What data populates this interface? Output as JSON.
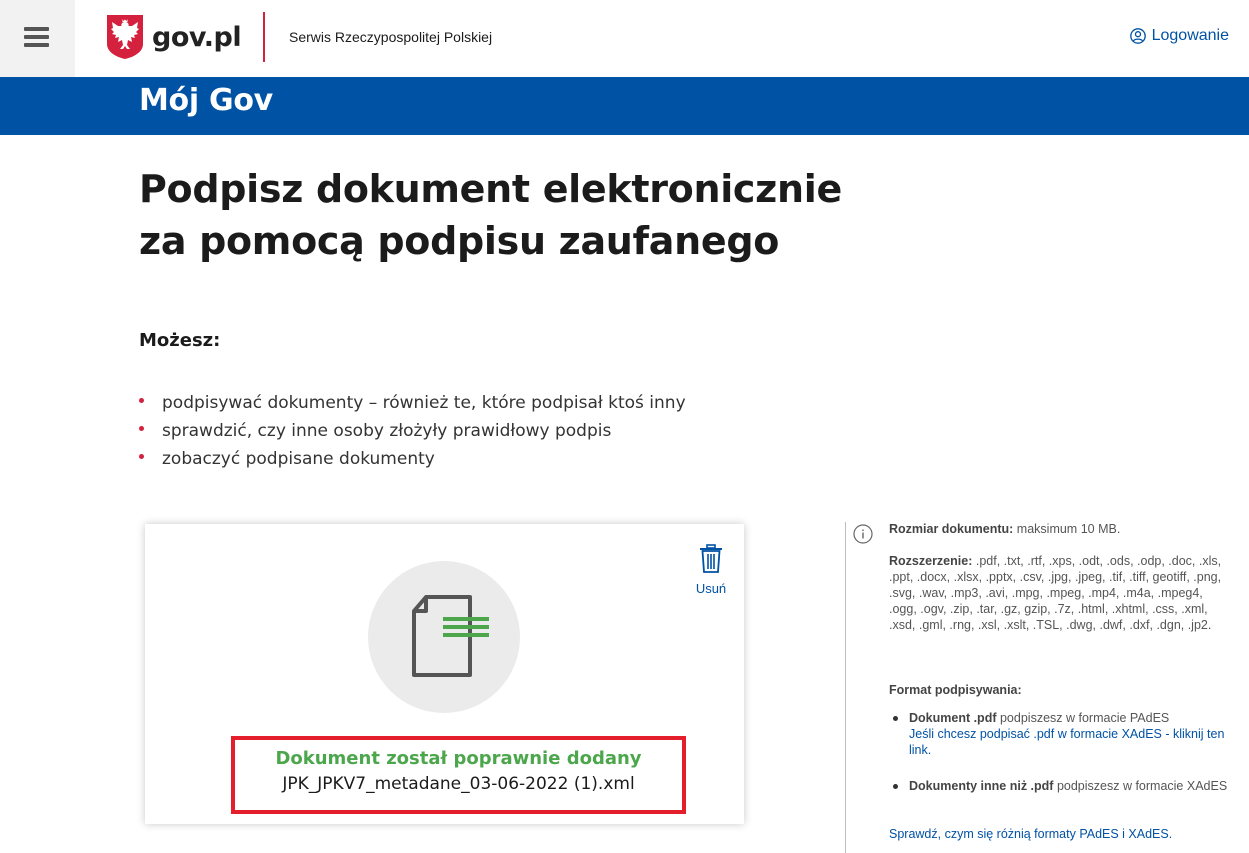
{
  "header": {
    "logo_text": "gov.pl",
    "service_name": "Serwis Rzeczypospolitej Polskiej",
    "login_label": "Logowanie"
  },
  "band": {
    "title": "Mój Gov"
  },
  "main": {
    "title_line1": "Podpisz dokument elektronicznie",
    "title_line2": "za pomocą podpisu zaufanego",
    "can_heading": "Możesz:",
    "bullets": [
      "podpisywać dokumenty – również te, które podpisał ktoś inny",
      "sprawdzić, czy inne osoby złożyły prawidłowy podpis",
      "zobaczyć podpisane dokumenty"
    ]
  },
  "upload": {
    "delete_label": "Usuń",
    "status_title": "Dokument został poprawnie dodany",
    "file_name": "JPK_JPKV7_metadane_03-06-2022 (1).xml"
  },
  "info": {
    "size_label": "Rozmiar dokumentu:",
    "size_value": "maksimum 10 MB.",
    "ext_label": "Rozszerzenie:",
    "ext_value": ".pdf, .txt, .rtf, .xps, .odt, .ods, .odp, .doc, .xls, .ppt, .docx, .xlsx, .pptx, .csv, .jpg, .jpeg, .tif, .tiff, geotiff, .png, .svg, .wav, .mp3, .avi, .mpg, .mpeg, .mp4, .m4a, .mpeg4, .ogg, .ogv, .zip, .tar, .gz, gzip, .7z, .html, .xhtml, .css, .xml, .xsd, .gml, .rng, .xsl, .xslt, .TSL, .dwg, .dwf, .dxf, .dgn, .jp2.",
    "format_heading": "Format podpisywania:",
    "pdf_bold": "Dokument .pdf",
    "pdf_text": "podpiszesz w formacie PAdES",
    "pdf_link": "Jeśli chcesz podpisać .pdf w formacie XAdES - kliknij ten link.",
    "other_bold": "Dokumenty inne niż .pdf",
    "other_text": "podpiszesz w formacie XAdES",
    "compare_link": "Sprawdź, czym się różnią formaty PAdES i XAdES."
  },
  "colors": {
    "brand_blue": "#0052a5",
    "accent_red": "#d4213d",
    "success_green": "#4ca64c",
    "highlight_red": "#e41e2b"
  }
}
